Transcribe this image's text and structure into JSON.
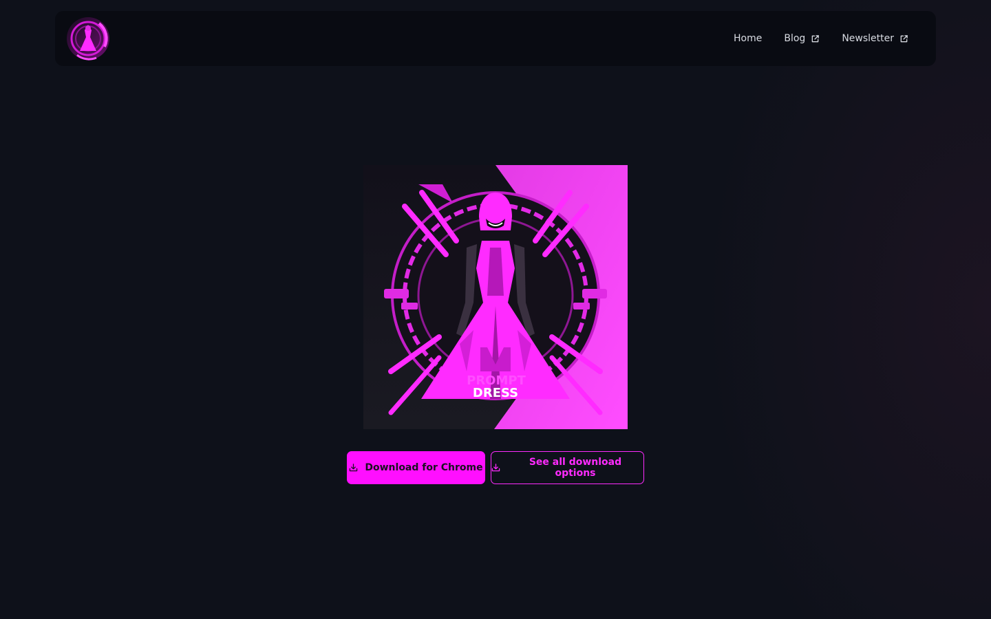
{
  "nav": {
    "logo_alt": "PROMPT DRESS",
    "links": [
      {
        "label": "Home",
        "external": false
      },
      {
        "label": "Blog",
        "external": true
      },
      {
        "label": "Newsletter",
        "external": true
      }
    ]
  },
  "hero": {
    "image_text_line1": "PROMPT",
    "image_text_line2": "DRESS"
  },
  "actions": {
    "primary_label": "Download for Chrome",
    "secondary_label": "See all download options"
  },
  "colors": {
    "background": "#0e111a",
    "navbar": "#090b12",
    "accent": "#ff0fff"
  },
  "icons": {
    "external": "external-link-icon",
    "download": "download-icon"
  }
}
